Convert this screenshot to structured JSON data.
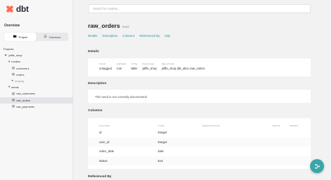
{
  "brand": {
    "name": "dbt",
    "accent": "#ff694a"
  },
  "sidebar": {
    "overview": "Overview",
    "view_switch": [
      {
        "label": "Project",
        "icon": "folder-icon",
        "active": true
      },
      {
        "label": "Database",
        "icon": "database-icon",
        "active": false
      }
    ],
    "tree": [
      {
        "label": "Projects",
        "level": 0,
        "icon": ""
      },
      {
        "label": "jaffle_shop",
        "level": 1,
        "icon": "folder-open-icon"
      },
      {
        "label": "models",
        "level": 2,
        "icon": "folder-open-icon"
      },
      {
        "label": "customers",
        "level": 3,
        "icon": "file-icon"
      },
      {
        "label": "orders",
        "level": 3,
        "icon": "file-icon"
      },
      {
        "label": "staging",
        "level": 3,
        "icon": "folder-icon",
        "muted": true
      },
      {
        "label": "seeds",
        "level": 2,
        "icon": "folder-open-icon"
      },
      {
        "label": "raw_customers",
        "level": 3,
        "icon": "file-icon"
      },
      {
        "label": "raw_orders",
        "level": 3,
        "icon": "file-icon",
        "selected": true
      },
      {
        "label": "raw_payments",
        "level": 3,
        "icon": "file-icon"
      }
    ]
  },
  "search": {
    "placeholder": "Search for models..."
  },
  "page": {
    "title": "raw_orders",
    "kind": "seed",
    "tabs": [
      "Details",
      "Description",
      "Columns",
      "Referenced By",
      "SQL"
    ]
  },
  "details": {
    "title": "Details",
    "fields": [
      {
        "label": "TAGS",
        "value": "untagged"
      },
      {
        "label": "OWNER",
        "value": "root"
      },
      {
        "label": "TYPE",
        "value": "table"
      },
      {
        "label": "PACKAGE",
        "value": "jaffle_shop"
      },
      {
        "label": "RELATION",
        "value": "jaffle_shop.dbt_alice.raw_orders"
      }
    ]
  },
  "description": {
    "title": "Description",
    "text": "This seed is not currently documented"
  },
  "columns": {
    "title": "Columns",
    "headers": [
      "COLUMN",
      "TYPE",
      "DESCRIPTION",
      "TESTS",
      "MORE?"
    ],
    "rows": [
      {
        "name": "id",
        "type": "integer"
      },
      {
        "name": "user_id",
        "type": "integer"
      },
      {
        "name": "order_date",
        "type": "date"
      },
      {
        "name": "status",
        "type": "text"
      }
    ]
  },
  "referenced_by": {
    "title": "Referenced By"
  },
  "fab": {
    "icon": "lineage-icon"
  }
}
